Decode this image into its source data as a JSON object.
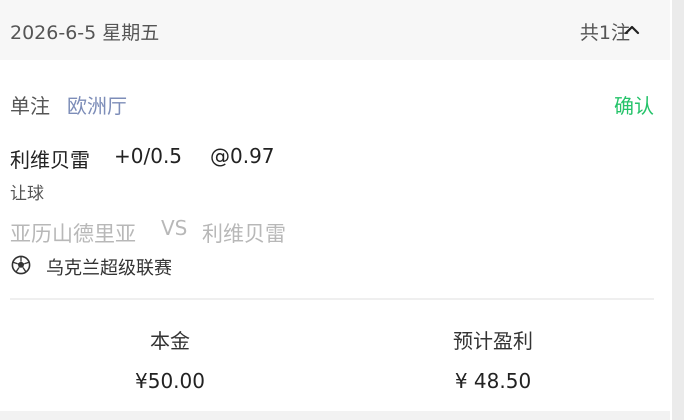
{
  "header": {
    "date": "2026-6-5 星期五",
    "total": "共1注"
  },
  "ticket": {
    "bet_type": "单注",
    "hall": "欧洲厅",
    "confirm_label": "确认",
    "selection_team": "利维贝雷",
    "handicap": "+0/0.5",
    "odds": "@0.97",
    "market": "让球",
    "home_team": "亚历山德里亚",
    "vs": "VS",
    "away_team": "利维贝雷",
    "league_icon": "soccer-ball-icon",
    "league": "乌克兰超级联赛"
  },
  "summary": {
    "stake_label": "本金",
    "stake_value": "¥50.00",
    "profit_label": "预计盈利",
    "profit_value": "¥ 48.50"
  },
  "colors": {
    "confirm": "#25c36a",
    "hall": "#7d8db8",
    "muted": "#b8b8b8"
  }
}
